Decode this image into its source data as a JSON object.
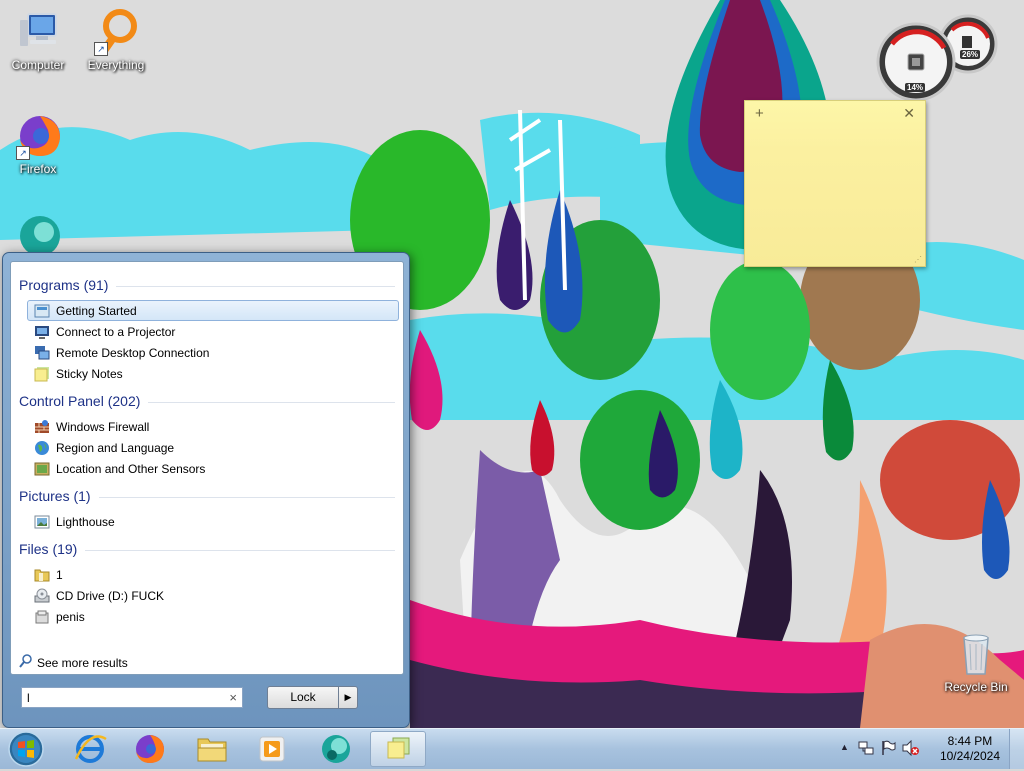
{
  "desktop": {
    "icons": [
      {
        "label": "Computer",
        "icon": "computer-icon"
      },
      {
        "label": "Everything",
        "icon": "everything-icon"
      },
      {
        "label": "Firefox",
        "icon": "firefox-icon"
      },
      {
        "label": "Recycle Bin",
        "icon": "recycle-bin-icon"
      }
    ]
  },
  "gadgets": {
    "cpu_meter": {
      "cpu_percent": "14%",
      "memory_percent": "26%"
    }
  },
  "start_menu": {
    "groups": [
      {
        "title": "Programs (91)",
        "items": [
          {
            "label": "Getting Started",
            "icon": "getting-started-icon",
            "selected": true
          },
          {
            "label": "Connect to a Projector",
            "icon": "projector-icon"
          },
          {
            "label": "Remote Desktop Connection",
            "icon": "remote-desktop-icon"
          },
          {
            "label": "Sticky Notes",
            "icon": "sticky-notes-icon"
          }
        ]
      },
      {
        "title": "Control Panel (202)",
        "items": [
          {
            "label": "Windows Firewall",
            "icon": "firewall-icon"
          },
          {
            "label": "Region and Language",
            "icon": "globe-icon"
          },
          {
            "label": "Location and Other Sensors",
            "icon": "sensors-icon"
          }
        ]
      },
      {
        "title": "Pictures (1)",
        "items": [
          {
            "label": "Lighthouse",
            "icon": "image-icon"
          }
        ]
      },
      {
        "title": "Files (19)",
        "items": [
          {
            "label": "1",
            "icon": "folder-icon"
          },
          {
            "label": "CD Drive (D:) FUCK",
            "icon": "cd-drive-icon"
          },
          {
            "label": "penis",
            "icon": "file-icon"
          }
        ]
      }
    ],
    "see_more": "See more results",
    "search_value": "l",
    "clear_glyph": "×",
    "lock_label": "Lock",
    "lock_arrow": "▶"
  },
  "taskbar": {
    "pinned": [
      "internet-explorer-icon",
      "firefox-icon",
      "explorer-folder-icon",
      "media-player-icon",
      "app-icon",
      "sticky-notes-icon"
    ],
    "tray_icons": [
      "show-hidden-icons-arrow",
      "network-icon",
      "action-center-flag-icon",
      "volume-muted-icon"
    ],
    "clock_time": "8:44 PM",
    "clock_date": "10/24/2024"
  },
  "colors": {
    "group_header": "#1e3287",
    "selection": "#d4e6f8",
    "sticky_note": "#fbf0a0"
  }
}
